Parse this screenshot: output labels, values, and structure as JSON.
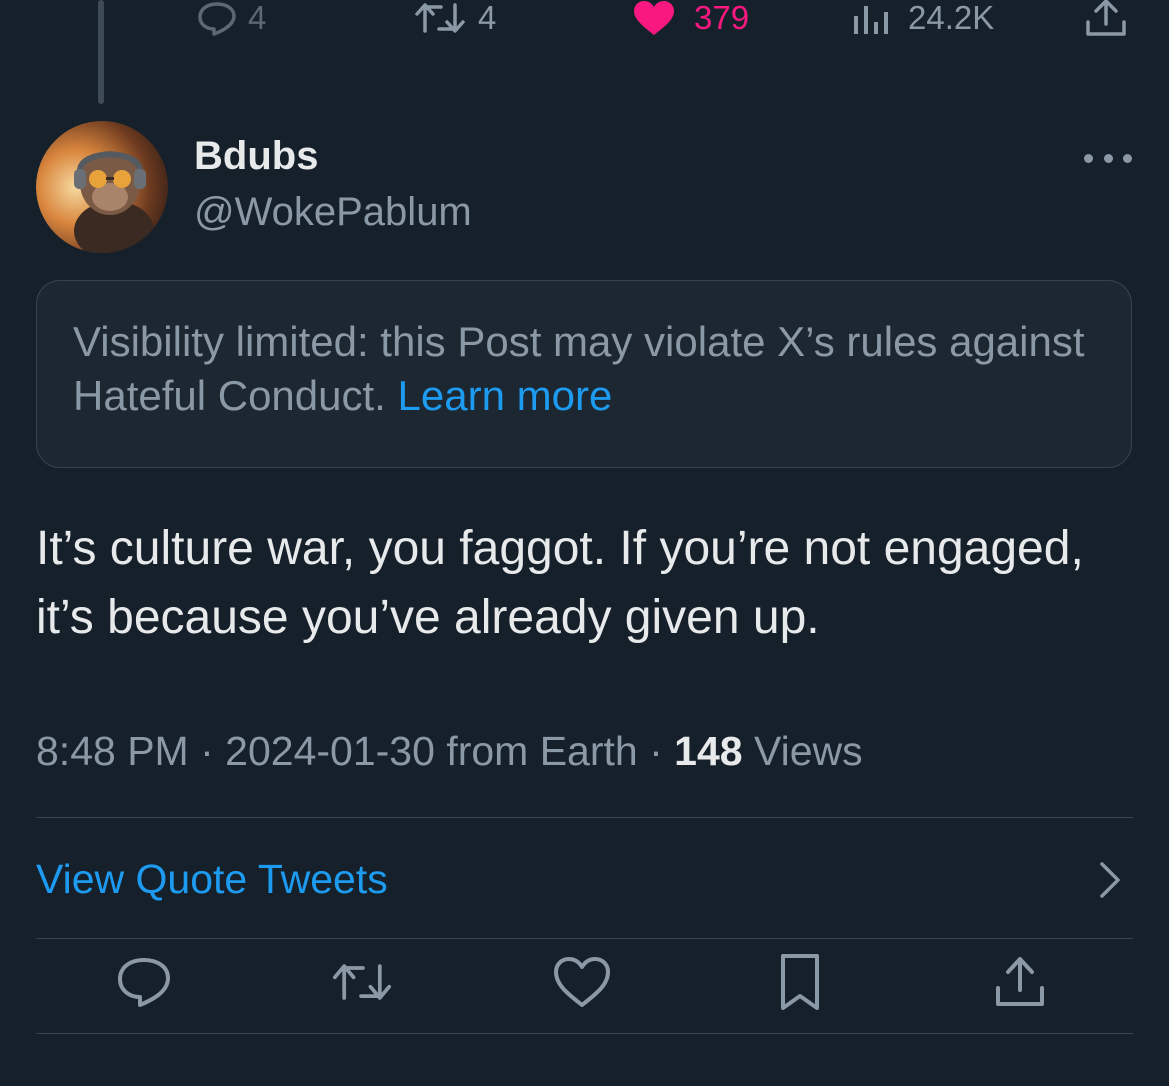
{
  "previous_tweet": {
    "reply_count": "4",
    "retweet_count": "4",
    "like_count": "379",
    "view_count": "24.2K"
  },
  "author": {
    "name": "Bdubs",
    "handle": "@WokePablum"
  },
  "notice": {
    "text": "Visibility limited: this Post may violate X’s rules against Hateful Conduct.",
    "link_label": "Learn more"
  },
  "tweet": {
    "text": "It’s culture war, you faggot. If you’re not engaged, it’s because you’ve already given up."
  },
  "meta": {
    "time": "8:48 PM",
    "date": "2024-01-30",
    "source": "from Earth",
    "separator": "·",
    "views_count": "148",
    "views_label": "Views"
  },
  "quote_tweets": {
    "label": "View Quote Tweets"
  },
  "actions": {
    "icons": [
      "reply-icon",
      "retweet-icon",
      "like-icon",
      "bookmark-icon",
      "share-icon"
    ]
  },
  "colors": {
    "background": "#15202b",
    "text_primary": "#e7e9ea",
    "text_secondary": "#8b98a5",
    "link": "#1d9bf0",
    "like": "#f91880",
    "border": "#38444d"
  }
}
